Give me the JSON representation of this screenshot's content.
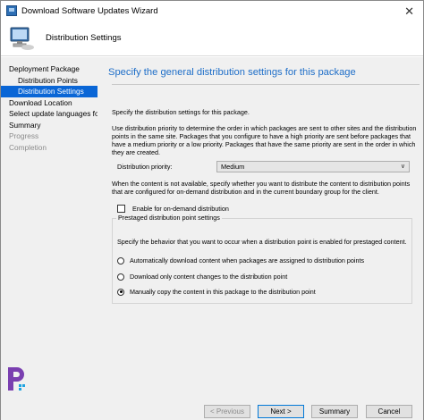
{
  "window": {
    "title": "Download Software Updates Wizard",
    "close_glyph": "✕"
  },
  "header": {
    "heading": "Distribution Settings",
    "icon": "computer-wizard-icon"
  },
  "sidebar": {
    "items": [
      {
        "label": "Deployment Package",
        "state": "normal"
      },
      {
        "label": "Distribution Points",
        "state": "normal"
      },
      {
        "label": "Distribution Settings",
        "state": "active"
      },
      {
        "label": "Download Location",
        "state": "normal"
      },
      {
        "label": "Select update languages for",
        "state": "normal"
      },
      {
        "label": "Summary",
        "state": "normal"
      },
      {
        "label": "Progress",
        "state": "disabled"
      },
      {
        "label": "Completion",
        "state": "disabled"
      }
    ]
  },
  "main": {
    "title": "Specify the general distribution settings for this package",
    "intro": "Specify the distribution settings for this package.",
    "priority_help_1": "Use distribution priority to determine the order in which packages are sent to other sites and the distribution",
    "priority_help_2": "points in the same site. Packages that you configure to have a high priority are sent before packages that",
    "priority_help_3": "have a medium priority or a low priority. Packages that have the same priority are sent in the order in which",
    "priority_help_4": "they are created.",
    "priority_label": "Distribution priority:",
    "priority_value": "Medium",
    "ondemand_help_1": "When the content is not available, specify whether you want to distribute the content to distribution points",
    "ondemand_help_2": "that are configured for on-demand distribution and in the current boundary group for the client.",
    "ondemand_checkbox_label": "Enable for on-demand distribution",
    "ondemand_checked": false,
    "prestaged": {
      "legend": "Prestaged distribution point settings",
      "help": "Specify the behavior that you want to occur when a distribution point is enabled for prestaged content.",
      "options": [
        {
          "label": "Automatically download content when packages are assigned to distribution points",
          "selected": false
        },
        {
          "label": "Download only content changes to the distribution point",
          "selected": false
        },
        {
          "label": "Manually copy the content in this package to the distribution point",
          "selected": true
        }
      ]
    }
  },
  "footer": {
    "previous": "< Previous",
    "next": "Next >",
    "summary": "Summary",
    "cancel": "Cancel"
  },
  "colors": {
    "accent_title": "#1e6ec8",
    "sidebar_active": "#0a66d6",
    "logo": "#7a3fb0"
  }
}
